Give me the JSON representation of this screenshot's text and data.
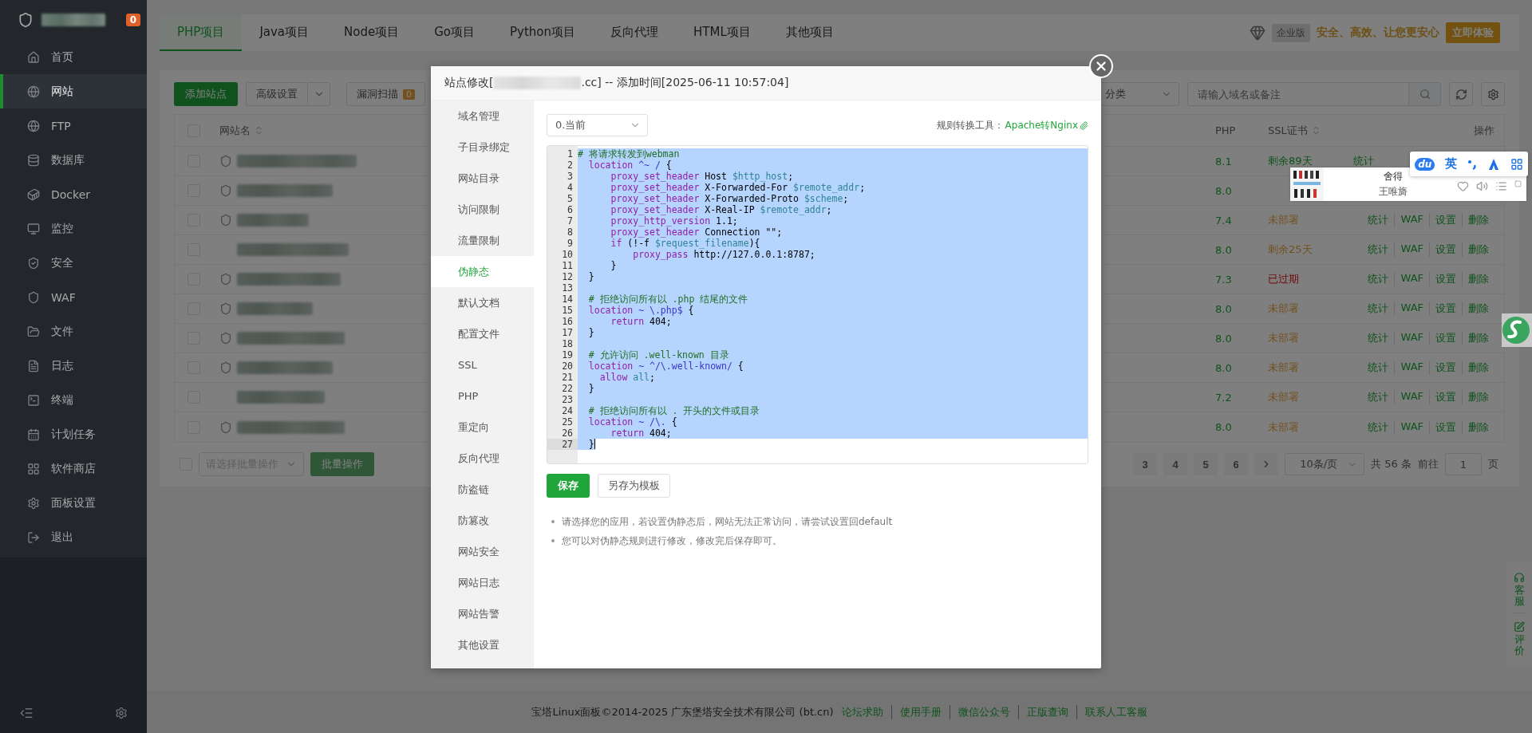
{
  "sidebar": {
    "badge": "0",
    "items": [
      {
        "label": "首页",
        "selected": false
      },
      {
        "label": "网站",
        "selected": true
      },
      {
        "label": "FTP",
        "selected": false
      },
      {
        "label": "数据库",
        "selected": false
      },
      {
        "label": "Docker",
        "selected": false
      },
      {
        "label": "监控",
        "selected": false
      },
      {
        "label": "安全",
        "selected": false
      },
      {
        "label": "WAF",
        "selected": false
      },
      {
        "label": "文件",
        "selected": false
      },
      {
        "label": "日志",
        "selected": false
      },
      {
        "label": "终端",
        "selected": false
      },
      {
        "label": "计划任务",
        "selected": false
      },
      {
        "label": "软件商店",
        "selected": false
      },
      {
        "label": "面板设置",
        "selected": false
      },
      {
        "label": "退出",
        "selected": false
      }
    ]
  },
  "tabs": [
    {
      "label": "PHP项目",
      "selected": true
    },
    {
      "label": "Java项目",
      "selected": false
    },
    {
      "label": "Node项目",
      "selected": false
    },
    {
      "label": "Go项目",
      "selected": false
    },
    {
      "label": "Python项目",
      "selected": false
    },
    {
      "label": "反向代理",
      "selected": false
    },
    {
      "label": "HTML项目",
      "selected": false
    },
    {
      "label": "其他项目",
      "selected": false
    }
  ],
  "promo": {
    "edition": "企业版",
    "slogan": "安全、高效、让您更安心",
    "button": "立即体验"
  },
  "toolbar": {
    "add": "添加站点",
    "advanced": "高级设置",
    "scan": "漏洞扫描",
    "scan_count": "0",
    "category": "分类",
    "search_placeholder": "请输入域名或备注"
  },
  "table": {
    "select_all_checked": false,
    "columns": [
      "网站名",
      "PHP",
      "SSL证书",
      "操作"
    ],
    "rows": [
      {
        "checked": false,
        "shield": true,
        "php": "8.1",
        "ssl": "剩余89天",
        "color": "#10521d",
        "actions": [
          "统计"
        ]
      },
      {
        "checked": false,
        "shield": true,
        "php": "8.0"
      },
      {
        "checked": false,
        "shield": true,
        "php": "7.4",
        "ssl": "未部署",
        "color": "#73511e",
        "actions": [
          "统计",
          "WAF",
          "设置",
          "删除"
        ]
      },
      {
        "checked": false,
        "shield": false,
        "php": "8.0",
        "ssl": "剩余25天",
        "color": "#73511e",
        "actions": [
          "统计",
          "WAF",
          "设置",
          "删除"
        ]
      },
      {
        "checked": false,
        "shield": true,
        "php": "7.3",
        "ssl": "已过期",
        "color": "#700808",
        "actions": [
          "统计",
          "WAF",
          "设置",
          "删除"
        ]
      },
      {
        "checked": false,
        "shield": true,
        "php": "8.0",
        "ssl": "未部署",
        "color": "#73511e",
        "actions": [
          "统计",
          "WAF",
          "设置",
          "删除"
        ]
      },
      {
        "checked": false,
        "shield": true,
        "php": "8.0",
        "ssl": "未部署",
        "color": "#73511e",
        "actions": [
          "统计",
          "WAF",
          "设置",
          "删除"
        ]
      },
      {
        "checked": false,
        "shield": true,
        "php": "8.0",
        "ssl": "未部署",
        "color": "#73511e",
        "actions": [
          "统计",
          "WAF",
          "设置",
          "删除"
        ]
      },
      {
        "checked": false,
        "shield": false,
        "php": "7.2",
        "ssl": "未部署",
        "color": "#73511e",
        "actions": [
          "统计",
          "WAF",
          "设置",
          "删除"
        ]
      },
      {
        "checked": false,
        "shield": true,
        "php": "8.0",
        "ssl": "未部署",
        "color": "#73511e",
        "actions": [
          "统计",
          "WAF",
          "设置",
          "删除"
        ]
      }
    ]
  },
  "batch": {
    "checked": false,
    "placeholder": "请选择批量操作",
    "button": "批量操作",
    "disabled": true
  },
  "pagination": {
    "pages": [
      {
        "label": "3",
        "selected": false
      },
      {
        "label": "4",
        "selected": false
      },
      {
        "label": "5",
        "selected": false
      },
      {
        "label": "6",
        "selected": false
      }
    ],
    "page_size": "10条/页",
    "total": "共 56 条",
    "goto": "前往",
    "page_input": "1",
    "page_unit": "页"
  },
  "footer": {
    "text": "宝塔Linux面板©2014-2025 广东堡塔安全技术有限公司 (bt.cn)",
    "links": [
      "论坛求助",
      "使用手册",
      "微信公众号",
      "正版查询",
      "联系人工客服"
    ]
  },
  "modal": {
    "title_prefix": "站点修改[",
    "title_suffix": ".cc] -- 添加时间[2025-06-11 10:57:04]",
    "nav": [
      {
        "label": "域名管理",
        "selected": false
      },
      {
        "label": "子目录绑定",
        "selected": false
      },
      {
        "label": "网站目录",
        "selected": false
      },
      {
        "label": "访问限制",
        "selected": false
      },
      {
        "label": "流量限制",
        "selected": false
      },
      {
        "label": "伪静态",
        "selected": true
      },
      {
        "label": "默认文档",
        "selected": false
      },
      {
        "label": "配置文件",
        "selected": false
      },
      {
        "label": "SSL",
        "selected": false
      },
      {
        "label": "PHP",
        "selected": false
      },
      {
        "label": "重定向",
        "selected": false
      },
      {
        "label": "反向代理",
        "selected": false
      },
      {
        "label": "防盗链",
        "selected": false
      },
      {
        "label": "防篡改",
        "selected": false
      },
      {
        "label": "网站安全",
        "selected": false
      },
      {
        "label": "网站日志",
        "selected": false
      },
      {
        "label": "网站告警",
        "selected": false
      },
      {
        "label": "其他设置",
        "selected": false
      }
    ],
    "version_select": "0.当前",
    "converter_label": "规则转换工具：",
    "converter_link": "Apache转Nginx",
    "lines": [
      {
        "number": "1",
        "selected": true,
        "active": false,
        "tokens": [
          {
            "kind": "comment",
            "text": "# 将请求转发到webman"
          }
        ]
      },
      {
        "number": "2",
        "selected": true,
        "active": false,
        "tokens": [
          {
            "kind": "keyword",
            "text": "  location"
          },
          {
            "kind": "regex",
            "text": " ^~ /"
          },
          {
            "kind": "plain",
            "text": " {"
          }
        ]
      },
      {
        "number": "3",
        "selected": true,
        "active": false,
        "tokens": [
          {
            "kind": "keyword",
            "text": "      proxy_set_header"
          },
          {
            "kind": "plain",
            "text": " Host "
          },
          {
            "kind": "variable",
            "text": "$http_host"
          },
          {
            "kind": "plain",
            "text": ";"
          }
        ]
      },
      {
        "number": "4",
        "selected": true,
        "active": false,
        "tokens": [
          {
            "kind": "keyword",
            "text": "      proxy_set_header"
          },
          {
            "kind": "plain",
            "text": " X-Forwarded-For "
          },
          {
            "kind": "variable",
            "text": "$remote_addr"
          },
          {
            "kind": "plain",
            "text": ";"
          }
        ]
      },
      {
        "number": "5",
        "selected": true,
        "active": false,
        "tokens": [
          {
            "kind": "keyword",
            "text": "      proxy_set_header"
          },
          {
            "kind": "plain",
            "text": " X-Forwarded-Proto "
          },
          {
            "kind": "variable",
            "text": "$scheme"
          },
          {
            "kind": "plain",
            "text": ";"
          }
        ]
      },
      {
        "number": "6",
        "selected": true,
        "active": false,
        "tokens": [
          {
            "kind": "keyword",
            "text": "      proxy_set_header"
          },
          {
            "kind": "plain",
            "text": " X-Real-IP "
          },
          {
            "kind": "variable",
            "text": "$remote_addr"
          },
          {
            "kind": "plain",
            "text": ";"
          }
        ]
      },
      {
        "number": "7",
        "selected": true,
        "active": false,
        "tokens": [
          {
            "kind": "keyword",
            "text": "      proxy_http_version"
          },
          {
            "kind": "plain",
            "text": " 1.1;"
          }
        ]
      },
      {
        "number": "8",
        "selected": true,
        "active": false,
        "tokens": [
          {
            "kind": "keyword",
            "text": "      proxy_set_header"
          },
          {
            "kind": "plain",
            "text": " Connection \"\";"
          }
        ]
      },
      {
        "number": "9",
        "selected": true,
        "active": false,
        "tokens": [
          {
            "kind": "keyword",
            "text": "      if"
          },
          {
            "kind": "plain",
            "text": " (!-f "
          },
          {
            "kind": "variable",
            "text": "$request_filename"
          },
          {
            "kind": "plain",
            "text": "){"
          }
        ]
      },
      {
        "number": "10",
        "selected": true,
        "active": false,
        "tokens": [
          {
            "kind": "keyword",
            "text": "          proxy_pass"
          },
          {
            "kind": "plain",
            "text": " http://127.0.0.1:8787;"
          }
        ]
      },
      {
        "number": "11",
        "selected": true,
        "active": false,
        "tokens": [
          {
            "kind": "plain",
            "text": "      }"
          }
        ]
      },
      {
        "number": "12",
        "selected": true,
        "active": false,
        "tokens": [
          {
            "kind": "plain",
            "text": "  }"
          }
        ]
      },
      {
        "number": "13",
        "selected": true,
        "active": false
      },
      {
        "number": "14",
        "selected": true,
        "active": false,
        "tokens": [
          {
            "kind": "comment",
            "text": "  # 拒绝访问所有以 .php 结尾的文件"
          }
        ]
      },
      {
        "number": "15",
        "selected": true,
        "active": false,
        "tokens": [
          {
            "kind": "keyword",
            "text": "  location"
          },
          {
            "kind": "regex",
            "text": " ~ \\.php$"
          },
          {
            "kind": "plain",
            "text": " {"
          }
        ]
      },
      {
        "number": "16",
        "selected": true,
        "active": false,
        "tokens": [
          {
            "kind": "keyword",
            "text": "      return"
          },
          {
            "kind": "plain",
            "text": " 404;"
          }
        ]
      },
      {
        "number": "17",
        "selected": true,
        "active": false,
        "tokens": [
          {
            "kind": "plain",
            "text": "  }"
          }
        ]
      },
      {
        "number": "18",
        "selected": true,
        "active": false
      },
      {
        "number": "19",
        "selected": true,
        "active": false,
        "tokens": [
          {
            "kind": "comment",
            "text": "  # 允许访问 .well-known 目录"
          }
        ]
      },
      {
        "number": "20",
        "selected": true,
        "active": false,
        "tokens": [
          {
            "kind": "keyword",
            "text": "  location"
          },
          {
            "kind": "regex",
            "text": " ~ ^/\\.well-known/"
          },
          {
            "kind": "plain",
            "text": " {"
          }
        ]
      },
      {
        "number": "21",
        "selected": true,
        "active": false,
        "tokens": [
          {
            "kind": "keyword",
            "text": "    allow"
          },
          {
            "kind": "variable",
            "text": " all"
          },
          {
            "kind": "plain",
            "text": ";"
          }
        ]
      },
      {
        "number": "22",
        "selected": true,
        "active": false,
        "tokens": [
          {
            "kind": "plain",
            "text": "  }"
          }
        ]
      },
      {
        "number": "23",
        "selected": true,
        "active": false
      },
      {
        "number": "24",
        "selected": true,
        "active": false,
        "tokens": [
          {
            "kind": "comment",
            "text": "  # 拒绝访问所有以 . 开头的文件或目录"
          }
        ]
      },
      {
        "number": "25",
        "selected": true,
        "active": false,
        "tokens": [
          {
            "kind": "keyword",
            "text": "  location"
          },
          {
            "kind": "regex",
            "text": " ~ /\\."
          },
          {
            "kind": "plain",
            "text": " {"
          }
        ]
      },
      {
        "number": "26",
        "selected": true,
        "active": false,
        "tokens": [
          {
            "kind": "keyword",
            "text": "      return"
          },
          {
            "kind": "plain",
            "text": " 404;"
          }
        ]
      },
      {
        "number": "27",
        "selected": true,
        "active": true,
        "tokens": [
          {
            "kind": "plain",
            "text": "  }"
          }
        ]
      }
    ],
    "save": "保存",
    "save_template": "另存为模板",
    "tips": [
      "请选择您的应用，若设置伪静态后，网站无法正常访问，请尝试设置回default",
      "您可以对伪静态规则进行修改，修改完后保存即可。"
    ]
  },
  "music_widget": {
    "title": "舍得",
    "artist": "王唯旖"
  },
  "ime_bar": {
    "logo": "du",
    "language": "英"
  },
  "side_float": [
    {
      "label": "客服",
      "kind": "service"
    },
    {
      "label": "评价",
      "kind": "feedback"
    }
  ]
}
